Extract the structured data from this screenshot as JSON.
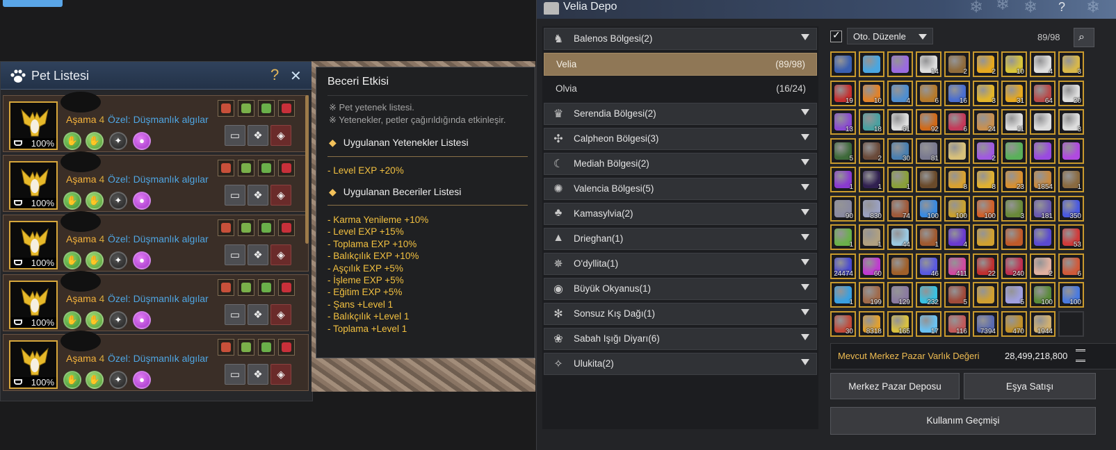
{
  "pet_panel": {
    "title": "Pet Listesi",
    "help_icon": "?",
    "pets": [
      {
        "stage_label": "Aşama",
        "stage_num": "4",
        "special": "Özel: Düşmanlık algılar",
        "percent": "100%",
        "skills": [
          "boar-icon",
          "pickaxe-icon",
          "clover-icon",
          "potion-icon"
        ]
      },
      {
        "stage_label": "Aşama",
        "stage_num": "4",
        "special": "Özel: Düşmanlık algılar",
        "percent": "100%",
        "skills": [
          "spider-icon",
          "sickle-icon",
          "feather-icon",
          "potion-icon"
        ]
      },
      {
        "stage_label": "Aşama",
        "stage_num": "4",
        "special": "Özel: Düşmanlık algılar",
        "percent": "100%",
        "skills": [
          "fish-icon",
          "tools-icon",
          "sickle-icon",
          "potion-icon"
        ]
      },
      {
        "stage_label": "Aşama",
        "stage_num": "4",
        "special": "Özel: Düşmanlık algılar",
        "percent": "100%",
        "skills": [
          "hoe-icon",
          "spider-icon",
          "sickle-icon",
          "potion-icon"
        ]
      },
      {
        "stage_label": "Aşama",
        "stage_num": "4",
        "special": "Özel: Düşmanlık algılar",
        "percent": "100%",
        "skills": [
          "hoe-icon",
          "tools-icon",
          "feather-icon",
          "potion-icon"
        ]
      }
    ]
  },
  "tooltip": {
    "title": "Beceri Etkisi",
    "notes": [
      "※ Pet yetenek listesi.",
      "※ Yetenekler, petler çağırıldığında etkinleşir."
    ],
    "section1": "Uygulanan Yetenekler Listesi",
    "section1_items": [
      "- Level EXP +20%"
    ],
    "section2": "Uygulanan Beceriler Listesi",
    "section2_items": [
      "- Karma Yenileme +10%",
      "- Level EXP +15%",
      "- Toplama EXP +10%",
      "- Balıkçılık EXP +10%",
      "- Aşçılık EXP +5%",
      "- İşleme EXP +5%",
      "- Eğitim EXP +5%",
      "- Şans +Level 1",
      "- Balıkçılık +Level 1",
      "- Toplama +Level 1"
    ]
  },
  "storage": {
    "title": "Velia Depo",
    "help_icon": "?",
    "regions": [
      {
        "label": "Balenos Bölgesi(2)",
        "icon": "horse-icon"
      },
      {
        "label": "Serendia Bölgesi(2)",
        "icon": "lion-icon"
      },
      {
        "label": "Calpheon Bölgesi(3)",
        "icon": "eagle-icon"
      },
      {
        "label": "Mediah Bölgesi(2)",
        "icon": "moon-icon"
      },
      {
        "label": "Valencia Bölgesi(5)",
        "icon": "sun-icon"
      },
      {
        "label": "Kamasylvia(2)",
        "icon": "tree-icon"
      },
      {
        "label": "Drieghan(1)",
        "icon": "mountain-icon"
      },
      {
        "label": "O'dyllita(1)",
        "icon": "star-icon"
      },
      {
        "label": "Büyük Okyanus(1)",
        "icon": "globe-icon"
      },
      {
        "label": "Sonsuz Kış Dağı(1)",
        "icon": "snowflake-icon"
      },
      {
        "label": "Sabah Işığı Diyarı(6)",
        "icon": "flower-icon"
      },
      {
        "label": "Ulukita(2)",
        "icon": "compass-icon"
      }
    ],
    "towns": [
      {
        "label": "Velia",
        "count": "(89/98)"
      },
      {
        "label": "Olvia",
        "count": "(16/24)"
      }
    ],
    "auto_sort_label": "Oto. Düzenle",
    "capacity": "89/98",
    "items": [
      {
        "c": "#3a5fb0",
        "q": ""
      },
      {
        "c": "#4aa6e0",
        "q": ""
      },
      {
        "c": "#9b6be0",
        "q": ""
      },
      {
        "c": "#ddd",
        "q": "14"
      },
      {
        "c": "#8f6b3c",
        "q": "2"
      },
      {
        "c": "#e6a81f",
        "q": "2"
      },
      {
        "c": "#d8c43a",
        "q": "10"
      },
      {
        "c": "#ddd",
        "q": "4"
      },
      {
        "c": "#d8b84a",
        "q": "3"
      },
      {
        "c": "#c43030",
        "q": "19"
      },
      {
        "c": "#e0822a",
        "q": "10"
      },
      {
        "c": "#4f8ecf",
        "q": "4"
      },
      {
        "c": "#b57a2c",
        "q": "6"
      },
      {
        "c": "#4a6ed0",
        "q": "16"
      },
      {
        "c": "#e2b52a",
        "q": "3"
      },
      {
        "c": "#e6a81f",
        "q": "31"
      },
      {
        "c": "#b84a4a",
        "q": "64"
      },
      {
        "c": "#ddd",
        "q": "20"
      },
      {
        "c": "#8a4ad0",
        "q": "13"
      },
      {
        "c": "#4aa0a0",
        "q": "18"
      },
      {
        "c": "#ddd",
        "q": "61"
      },
      {
        "c": "#d06a1a",
        "q": "92"
      },
      {
        "c": "#c43a5a",
        "q": "6"
      },
      {
        "c": "#c89050",
        "q": "24"
      },
      {
        "c": "#ddd",
        "q": "11"
      },
      {
        "c": "#ddd",
        "q": ""
      },
      {
        "c": "#ddd",
        "q": "3"
      },
      {
        "c": "#3e6a3a",
        "q": "5"
      },
      {
        "c": "#6a4a3a",
        "q": "2"
      },
      {
        "c": "#4a7fb0",
        "q": "30"
      },
      {
        "c": "#7a7a90",
        "q": "81"
      },
      {
        "c": "#d8c07a",
        "q": ""
      },
      {
        "c": "#a05ae0",
        "q": "2"
      },
      {
        "c": "#5ab05a",
        "q": ""
      },
      {
        "c": "#9a4ae0",
        "q": ""
      },
      {
        "c": "#b04ae0",
        "q": ""
      },
      {
        "c": "#8a3ad0",
        "q": "1"
      },
      {
        "c": "#302050",
        "q": "1"
      },
      {
        "c": "#8aa03a",
        "q": "1"
      },
      {
        "c": "#6a4a2a",
        "q": ""
      },
      {
        "c": "#d8a030",
        "q": "8"
      },
      {
        "c": "#e0b030",
        "q": "8"
      },
      {
        "c": "#d89030",
        "q": "23"
      },
      {
        "c": "#c88a40",
        "q": "1854"
      },
      {
        "c": "#8a6a40",
        "q": "1"
      },
      {
        "c": "#8a8aa0",
        "q": "90"
      },
      {
        "c": "#9aa0c0",
        "q": "830"
      },
      {
        "c": "#a05a3a",
        "q": "74"
      },
      {
        "c": "#3a8ae0",
        "q": "100"
      },
      {
        "c": "#c8a030",
        "q": "100"
      },
      {
        "c": "#d0602a",
        "q": "100"
      },
      {
        "c": "#6a8a3a",
        "q": "3"
      },
      {
        "c": "#6a5ab0",
        "q": "181"
      },
      {
        "c": "#4a5ae0",
        "q": "350"
      },
      {
        "c": "#6ab04a",
        "q": "1"
      },
      {
        "c": "#b0a080",
        "q": "1"
      },
      {
        "c": "#9ac8e0",
        "q": "44"
      },
      {
        "c": "#a05a30",
        "q": "1"
      },
      {
        "c": "#6a3ad0",
        "q": "4"
      },
      {
        "c": "#d0a030",
        "q": ""
      },
      {
        "c": "#c05a2a",
        "q": ""
      },
      {
        "c": "#5a4ad0",
        "q": ""
      },
      {
        "c": "#d03a3a",
        "q": "53"
      },
      {
        "c": "#4a4ad0",
        "q": "24474"
      },
      {
        "c": "#c03ad0",
        "q": "60"
      },
      {
        "c": "#a0602a",
        "q": ""
      },
      {
        "c": "#5a5ae0",
        "q": "46"
      },
      {
        "c": "#d04aa0",
        "q": "411"
      },
      {
        "c": "#c03030",
        "q": "22"
      },
      {
        "c": "#c03050",
        "q": "240"
      },
      {
        "c": "#e0b0a0",
        "q": "2"
      },
      {
        "c": "#d05a3a",
        "q": "6"
      },
      {
        "c": "#3aa0e0",
        "q": "1"
      },
      {
        "c": "#a06a4a",
        "q": "199"
      },
      {
        "c": "#8a7aa0",
        "q": "129"
      },
      {
        "c": "#3ac0e0",
        "q": "232"
      },
      {
        "c": "#a04a3a",
        "q": "5"
      },
      {
        "c": "#d0a030",
        "q": ""
      },
      {
        "c": "#a0a0e0",
        "q": "5"
      },
      {
        "c": "#5a8a3a",
        "q": "100"
      },
      {
        "c": "#4a7ae0",
        "q": "100"
      },
      {
        "c": "#c04a3a",
        "q": "30"
      },
      {
        "c": "#e0a030",
        "q": "8318"
      },
      {
        "c": "#d8c040",
        "q": "165"
      },
      {
        "c": "#6ac0f0",
        "q": "17"
      },
      {
        "c": "#c05a5a",
        "q": "116"
      },
      {
        "c": "#5a6ab0",
        "q": "7394"
      },
      {
        "c": "#c0902a",
        "q": "470"
      },
      {
        "c": "#d0b070",
        "q": "1944"
      },
      {
        "c": "",
        "q": ""
      }
    ],
    "market_label": "Mevcut Merkez Pazar Varlık Değeri",
    "market_value": "28,499,218,800",
    "buttons": {
      "market_storage": "Merkez Pazar Deposu",
      "item_sale": "Eşya Satışı",
      "history": "Kullanım Geçmişi"
    }
  }
}
